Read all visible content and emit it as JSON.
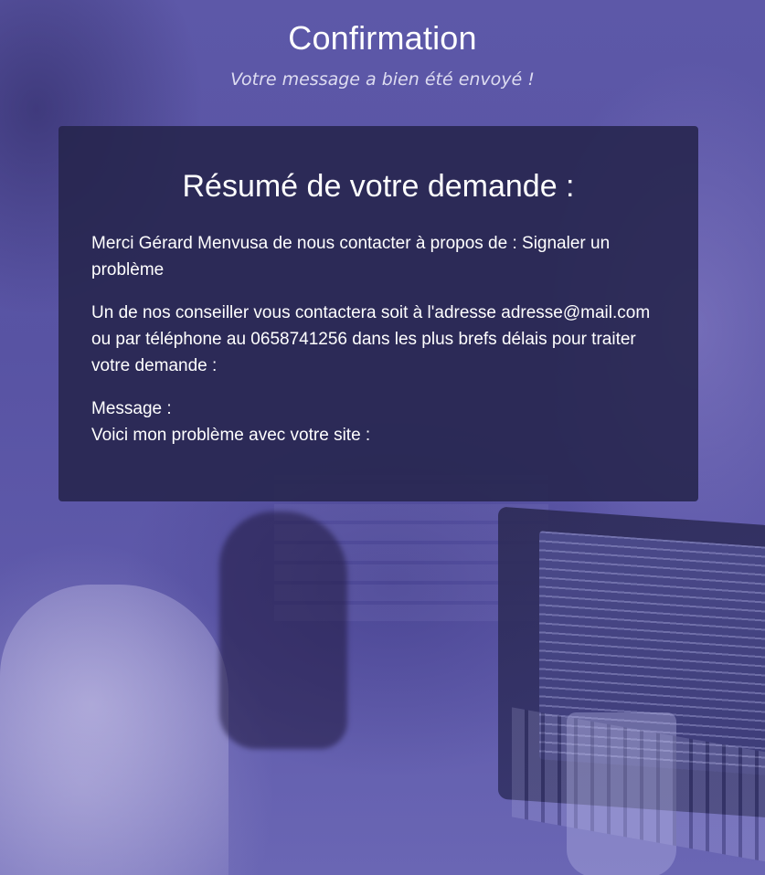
{
  "header": {
    "title": "Confirmation",
    "subtitle": "Votre message a bien été envoyé !"
  },
  "summary": {
    "heading": "Résumé de votre demande :",
    "thanks": "Merci Gérard Menvusa de nous contacter à propos de : Signaler un problème",
    "contact_info": "Un de nos conseiller vous contactera soit à l'adresse adresse@mail.com ou par téléphone au 0658741256 dans les plus brefs délais pour traiter votre demande :",
    "message_label": "Message :",
    "message_text": "Voici mon problème avec votre site :"
  },
  "colors": {
    "overlay": "#5d58a8",
    "card_background": "#26244c",
    "text": "#ffffff"
  }
}
